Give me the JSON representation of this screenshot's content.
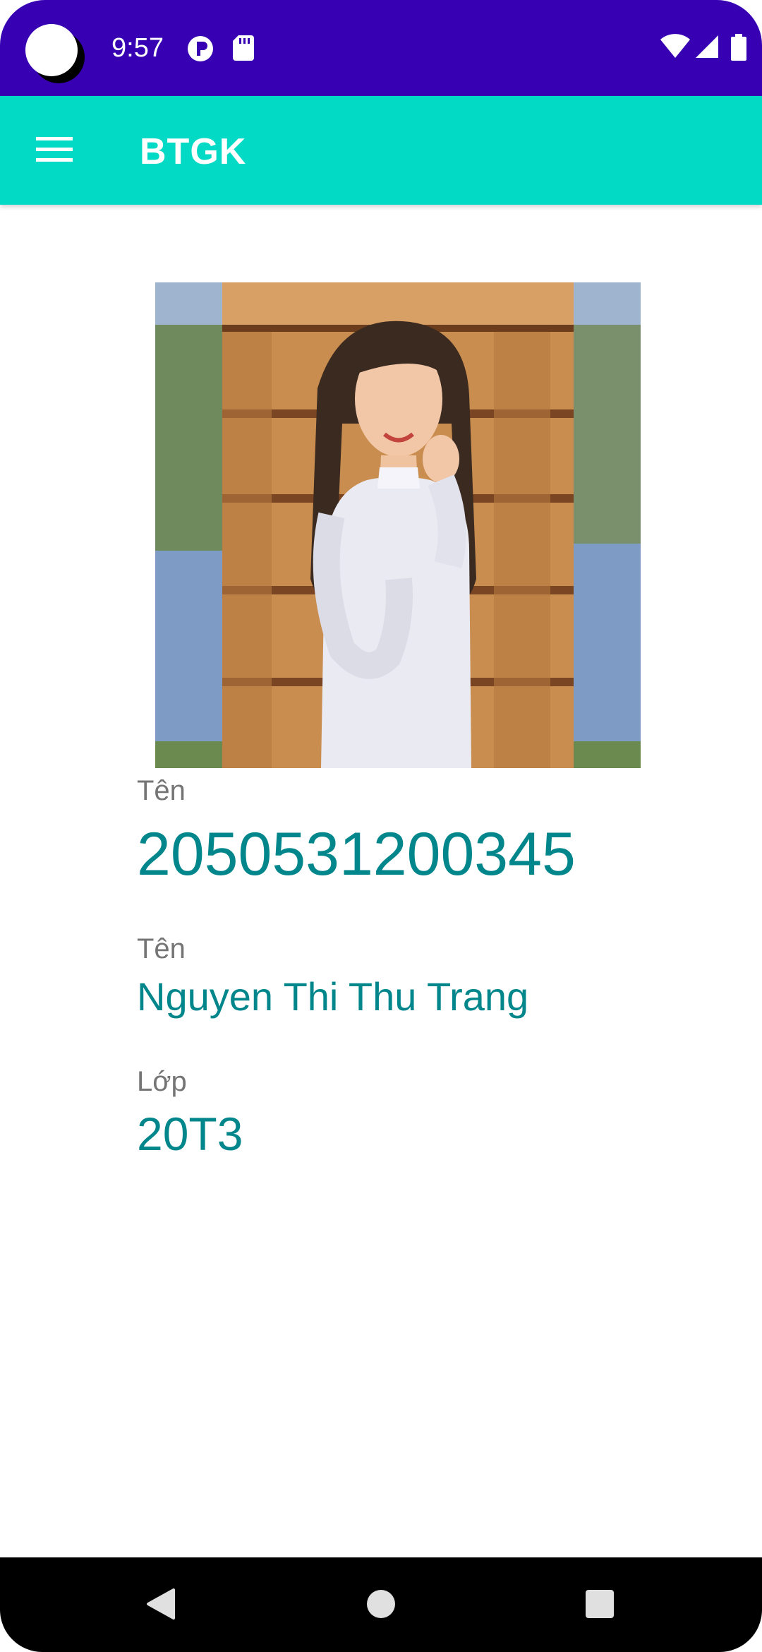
{
  "status_bar": {
    "time": "9:57",
    "background": "#3700B3",
    "icons": [
      "p-badge-icon",
      "sd-card-icon",
      "wifi-icon",
      "cell-signal-icon",
      "battery-icon"
    ]
  },
  "app_bar": {
    "title": "BTGK",
    "background": "#03DAC5",
    "menu_icon": "hamburger-menu-icon"
  },
  "profile": {
    "photo_label": "portrait photo",
    "fields": [
      {
        "label": "Tên",
        "value": "2050531200345"
      },
      {
        "label": "Tên",
        "value": "Nguyen Thi Thu Trang"
      },
      {
        "label": "Lớp",
        "value": "20T3"
      }
    ],
    "label_color": "#757575",
    "value_color": "#00868B"
  },
  "nav_bar": {
    "icons": [
      "back-icon",
      "home-icon",
      "recent-apps-icon"
    ]
  }
}
